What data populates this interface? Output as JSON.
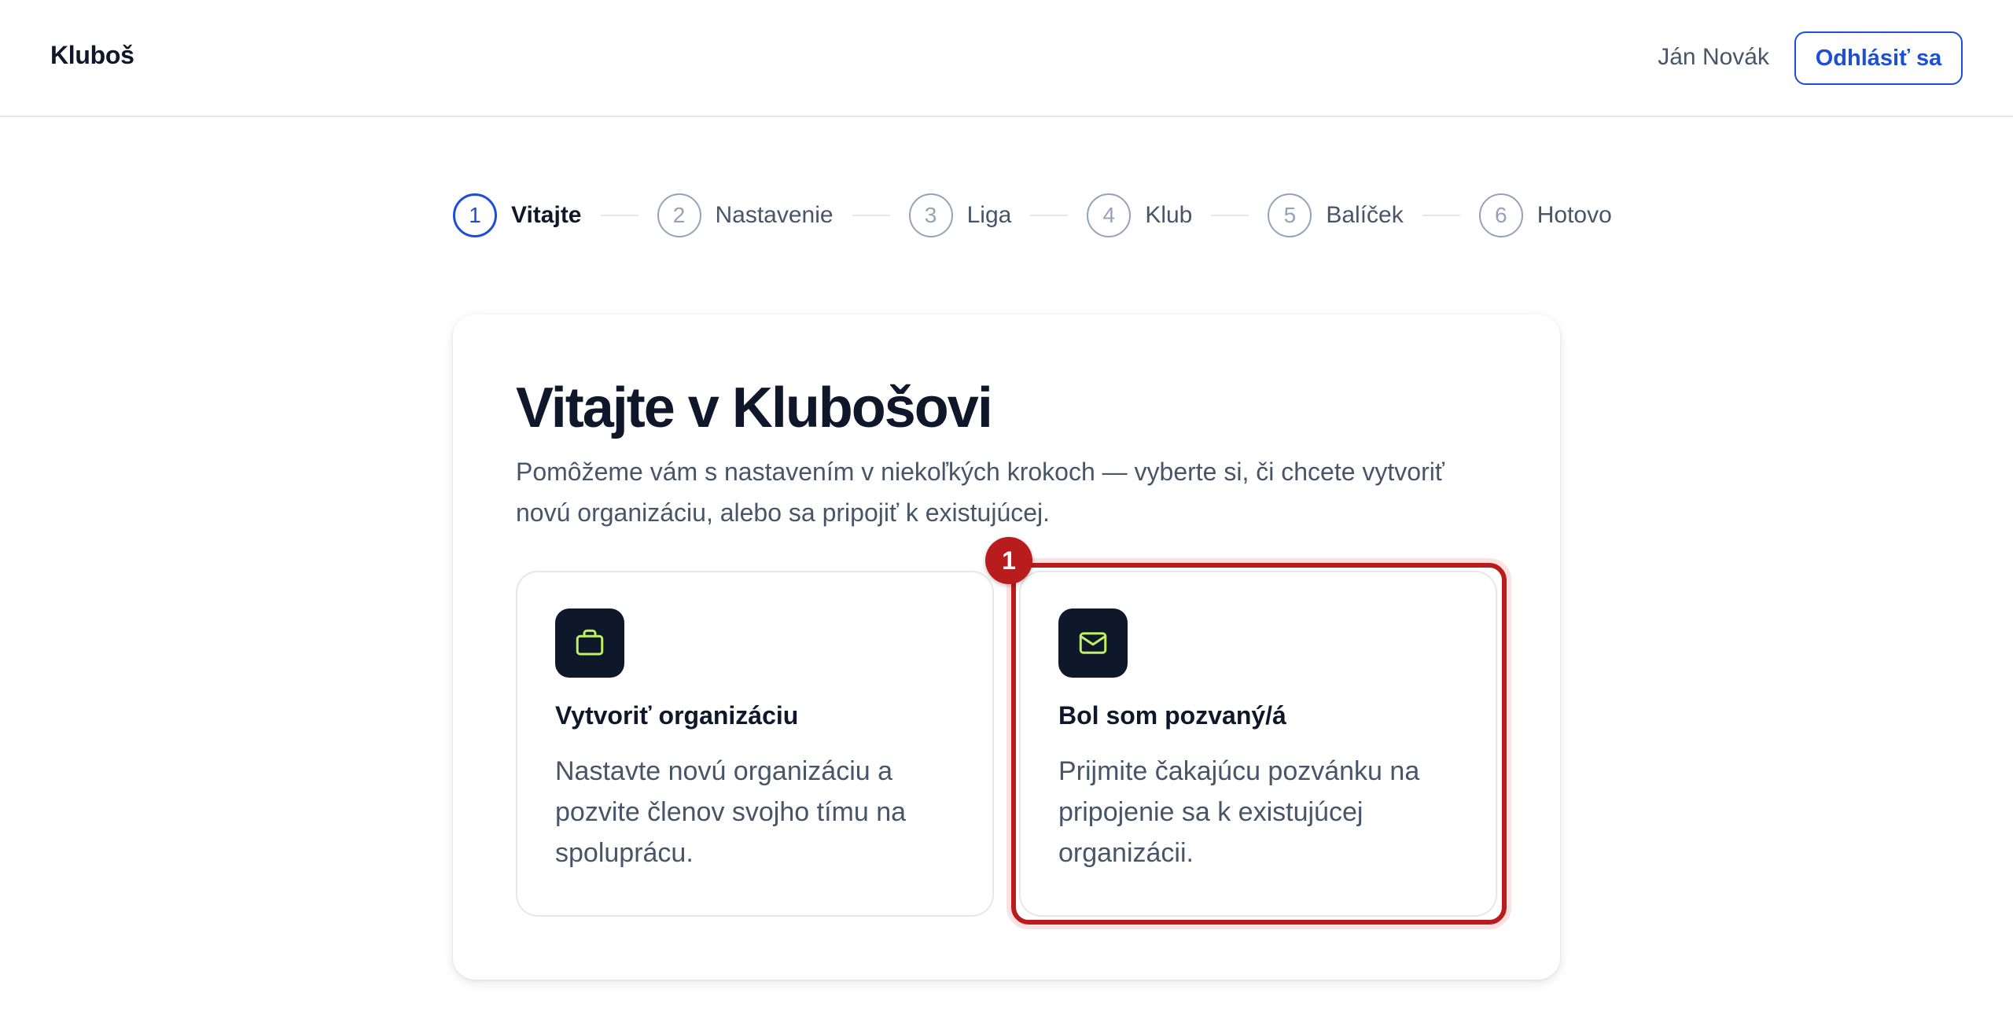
{
  "header": {
    "brand": "Kluboš",
    "user_name": "Ján Novák",
    "logout_label": "Odhlásiť sa"
  },
  "stepper": {
    "steps": [
      {
        "number": "1",
        "label": "Vitajte",
        "active": true
      },
      {
        "number": "2",
        "label": "Nastavenie",
        "active": false
      },
      {
        "number": "3",
        "label": "Liga",
        "active": false
      },
      {
        "number": "4",
        "label": "Klub",
        "active": false
      },
      {
        "number": "5",
        "label": "Balíček",
        "active": false
      },
      {
        "number": "6",
        "label": "Hotovo",
        "active": false
      }
    ]
  },
  "main": {
    "title": "Vitajte v Klubošovi",
    "subtitle": "Pomôžeme vám s nastavením v niekoľkých krokoch — vyberte si, či chcete vytvoriť novú organizáciu, alebo sa pripojiť k existujúcej.",
    "options": [
      {
        "icon": "briefcase-icon",
        "title": "Vytvoriť organizáciu",
        "description": "Nastavte novú organizáciu a pozvite členov svojho tímu na spoluprácu."
      },
      {
        "icon": "mail-icon",
        "title": "Bol som pozvaný/á",
        "description": "Prijmite čakajúcu pozvánku na pripojenie sa k existujúcej organizácii."
      }
    ]
  },
  "annotation": {
    "badge": "1"
  },
  "colors": {
    "accent": "#1d4ed8",
    "icon_bg": "#0f172a",
    "icon_stroke": "#bef264",
    "highlight": "#b91c1c"
  }
}
